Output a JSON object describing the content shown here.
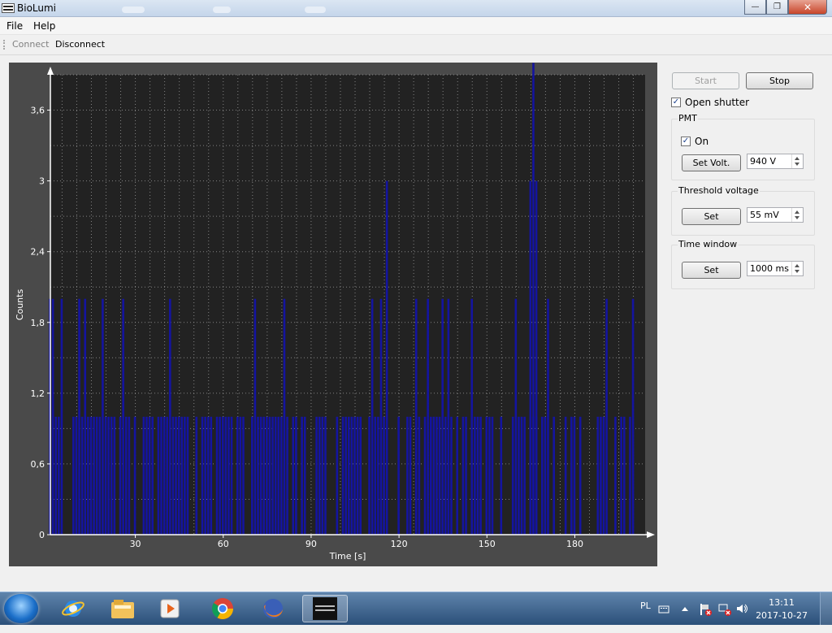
{
  "window": {
    "title": "BioLumi"
  },
  "menu": {
    "file": "File",
    "help": "Help"
  },
  "toolbar": {
    "connect": "Connect",
    "disconnect": "Disconnect"
  },
  "controls": {
    "start": "Start",
    "stop": "Stop",
    "open_shutter": {
      "label": "Open shutter",
      "checked": true
    },
    "pmt": {
      "title": "PMT",
      "on_label": "On",
      "on_checked": true,
      "set_button": "Set Volt.",
      "value": "940 V"
    },
    "threshold": {
      "title": "Threshold voltage",
      "set_button": "Set",
      "value": "55 mV"
    },
    "time_window": {
      "title": "Time window",
      "set_button": "Set",
      "value": "1000 ms"
    }
  },
  "chart_data": {
    "type": "bar",
    "xlabel": "Time [s]",
    "ylabel": "Counts",
    "xlim": [
      1,
      204
    ],
    "ylim": [
      0,
      3.9
    ],
    "x_ticks": [
      30,
      60,
      90,
      120,
      150,
      180
    ],
    "x_tick_labels": [
      "30",
      "60",
      "90",
      "120",
      "150",
      "180"
    ],
    "y_ticks": [
      0,
      0.6,
      1.2,
      1.8,
      2.4,
      3,
      3.6
    ],
    "y_tick_labels": [
      "0",
      "0,6",
      "1,2",
      "1,8",
      "2,4",
      "3",
      "3,6"
    ],
    "grid": true,
    "bar_color": "#1414a0",
    "background": "#222222",
    "x": [
      1,
      2,
      3,
      4,
      5,
      9,
      10,
      11,
      12,
      13,
      14,
      15,
      16,
      17,
      18,
      19,
      20,
      21,
      22,
      23,
      25,
      26,
      27,
      28,
      30,
      33,
      34,
      35,
      36,
      38,
      39,
      40,
      41,
      42,
      43,
      44,
      45,
      46,
      47,
      48,
      51,
      53,
      54,
      55,
      56,
      58,
      59,
      60,
      61,
      62,
      63,
      65,
      66,
      67,
      70,
      71,
      72,
      73,
      74,
      75,
      76,
      77,
      78,
      79,
      80,
      81,
      82,
      84,
      85,
      87,
      88,
      92,
      93,
      94,
      95,
      99,
      101,
      102,
      103,
      104,
      105,
      106,
      107,
      110,
      111,
      112,
      113,
      114,
      115,
      116,
      120,
      123,
      124,
      126,
      127,
      129,
      130,
      131,
      132,
      133,
      134,
      135,
      136,
      137,
      138,
      140,
      142,
      143,
      145,
      146,
      147,
      148,
      150,
      151,
      152,
      155,
      159,
      160,
      161,
      162,
      163,
      165,
      166,
      167,
      169,
      170,
      171,
      173,
      177,
      179,
      180,
      182,
      188,
      189,
      190,
      191,
      194,
      196,
      197,
      199,
      200
    ],
    "values": [
      2,
      2,
      1,
      1,
      2,
      1,
      1,
      2,
      1,
      2,
      1,
      1,
      1,
      1,
      1,
      2,
      1,
      1,
      1,
      1,
      1,
      2,
      1,
      1,
      1,
      1,
      1,
      1,
      1,
      1,
      1,
      1,
      1,
      2,
      1,
      1,
      1,
      1,
      1,
      1,
      1,
      1,
      1,
      1,
      1,
      1,
      1,
      1,
      1,
      1,
      1,
      1,
      1,
      1,
      1,
      2,
      1,
      1,
      1,
      1,
      1,
      1,
      1,
      1,
      1,
      2,
      1,
      1,
      1,
      1,
      1,
      1,
      1,
      1,
      1,
      1,
      1,
      1,
      1,
      1,
      1,
      1,
      1,
      1,
      2,
      1,
      1,
      2,
      1,
      3,
      1,
      1,
      1,
      2,
      1,
      1,
      2,
      1,
      1,
      1,
      1,
      2,
      1,
      2,
      1,
      1,
      1,
      1,
      2,
      1,
      1,
      1,
      1,
      1,
      1,
      1,
      1,
      2,
      1,
      1,
      1,
      1,
      1,
      1,
      1,
      1,
      2,
      1,
      1,
      1,
      1,
      1,
      1,
      1,
      1,
      2,
      1,
      1,
      1,
      1,
      2,
      1
    ],
    "extra_peaks": {
      "x": [
        165,
        166,
        167
      ],
      "values": [
        3,
        4,
        3
      ]
    }
  },
  "taskbar": {
    "apps": [
      "internet-explorer-icon",
      "file-explorer-icon",
      "media-player-icon",
      "chrome-icon",
      "firefox-icon",
      "biolumi-icon"
    ],
    "lang": "PL",
    "time": "13:11",
    "date": "2017-10-27"
  }
}
